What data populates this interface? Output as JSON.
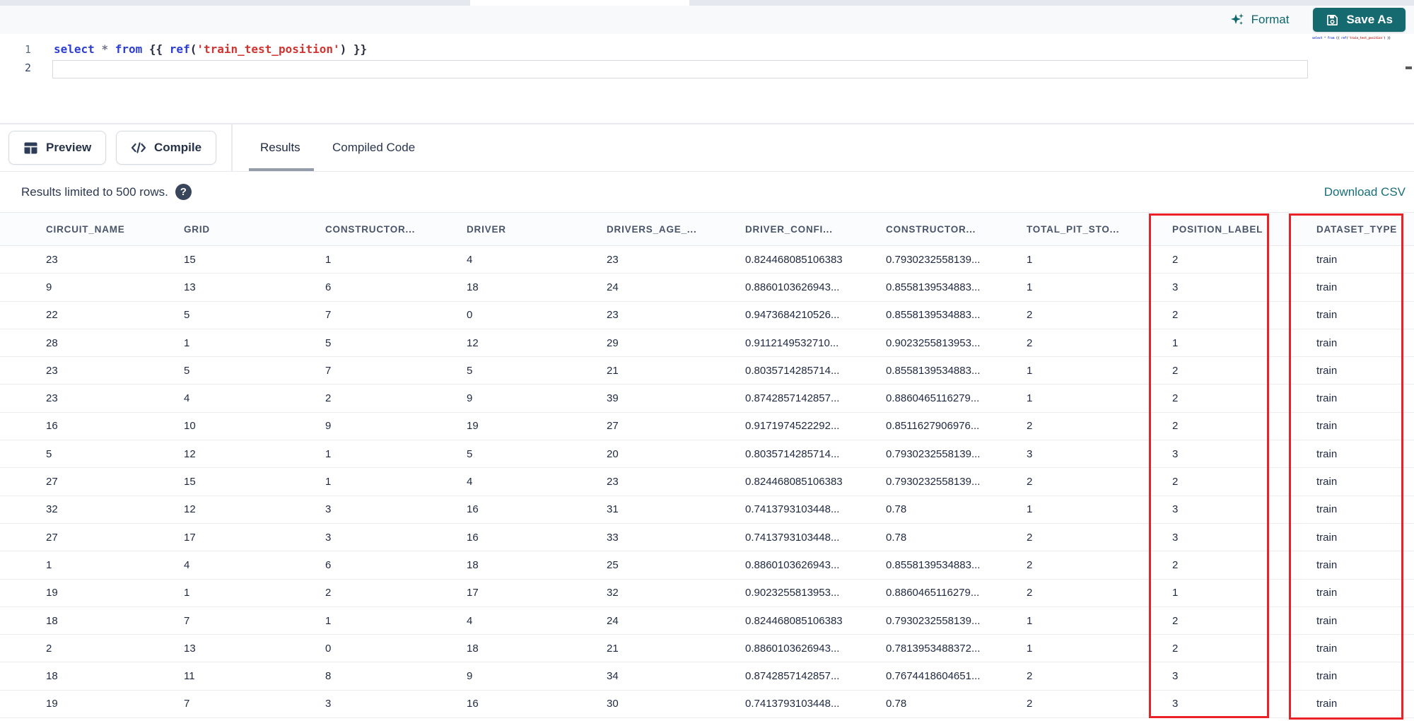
{
  "toolbar": {
    "format_label": "Format",
    "save_as_label": "Save As"
  },
  "editor": {
    "line_numbers": [
      "1",
      "2"
    ],
    "lines": [
      {
        "number": "1",
        "tokens": [
          {
            "t": "select",
            "c": "keyword"
          },
          {
            "t": " ",
            "c": "plain"
          },
          {
            "t": "*",
            "c": "operator"
          },
          {
            "t": " ",
            "c": "plain"
          },
          {
            "t": "from",
            "c": "keyword"
          },
          {
            "t": " ",
            "c": "plain"
          },
          {
            "t": "{{",
            "c": "brace"
          },
          {
            "t": " ",
            "c": "plain"
          },
          {
            "t": "ref",
            "c": "keyword"
          },
          {
            "t": "(",
            "c": "brace"
          },
          {
            "t": "'train_test_position'",
            "c": "string"
          },
          {
            "t": ")",
            "c": "brace"
          },
          {
            "t": " ",
            "c": "plain"
          },
          {
            "t": "}}",
            "c": "brace"
          }
        ]
      },
      {
        "number": "2",
        "tokens": []
      }
    ]
  },
  "actions": {
    "preview_label": "Preview",
    "compile_label": "Compile"
  },
  "tabs": {
    "results_label": "Results",
    "compiled_code_label": "Compiled Code",
    "active": "Results"
  },
  "results_info": {
    "limit_text": "Results limited to 500 rows.",
    "help_glyph": "?",
    "download_csv_label": "Download CSV"
  },
  "results_table": {
    "columns": [
      "CIRCUIT_NAME",
      "GRID",
      "CONSTRUCTOR...",
      "DRIVER",
      "DRIVERS_AGE_...",
      "DRIVER_CONFI...",
      "CONSTRUCTOR...",
      "TOTAL_PIT_STO...",
      "POSITION_LABEL",
      "DATASET_TYPE"
    ],
    "highlighted_columns": [
      "POSITION_LABEL",
      "DATASET_TYPE"
    ],
    "rows": [
      [
        "23",
        "15",
        "1",
        "4",
        "23",
        "0.824468085106383",
        "0.7930232558139...",
        "1",
        "2",
        "train"
      ],
      [
        "9",
        "13",
        "6",
        "18",
        "24",
        "0.8860103626943...",
        "0.8558139534883...",
        "1",
        "3",
        "train"
      ],
      [
        "22",
        "5",
        "7",
        "0",
        "23",
        "0.9473684210526...",
        "0.8558139534883...",
        "2",
        "2",
        "train"
      ],
      [
        "28",
        "1",
        "5",
        "12",
        "29",
        "0.9112149532710...",
        "0.9023255813953...",
        "2",
        "1",
        "train"
      ],
      [
        "23",
        "5",
        "7",
        "5",
        "21",
        "0.8035714285714...",
        "0.8558139534883...",
        "1",
        "2",
        "train"
      ],
      [
        "23",
        "4",
        "2",
        "9",
        "39",
        "0.8742857142857...",
        "0.8860465116279...",
        "1",
        "2",
        "train"
      ],
      [
        "16",
        "10",
        "9",
        "19",
        "27",
        "0.9171974522292...",
        "0.8511627906976...",
        "2",
        "2",
        "train"
      ],
      [
        "5",
        "12",
        "1",
        "5",
        "20",
        "0.8035714285714...",
        "0.7930232558139...",
        "3",
        "3",
        "train"
      ],
      [
        "27",
        "15",
        "1",
        "4",
        "23",
        "0.824468085106383",
        "0.7930232558139...",
        "2",
        "2",
        "train"
      ],
      [
        "32",
        "12",
        "3",
        "16",
        "31",
        "0.7413793103448...",
        "0.78",
        "1",
        "3",
        "train"
      ],
      [
        "27",
        "17",
        "3",
        "16",
        "33",
        "0.7413793103448...",
        "0.78",
        "2",
        "3",
        "train"
      ],
      [
        "1",
        "4",
        "6",
        "18",
        "25",
        "0.8860103626943...",
        "0.8558139534883...",
        "2",
        "2",
        "train"
      ],
      [
        "19",
        "1",
        "2",
        "17",
        "32",
        "0.9023255813953...",
        "0.8860465116279...",
        "2",
        "1",
        "train"
      ],
      [
        "18",
        "7",
        "1",
        "4",
        "24",
        "0.824468085106383",
        "0.7930232558139...",
        "1",
        "2",
        "train"
      ],
      [
        "2",
        "13",
        "0",
        "18",
        "21",
        "0.8860103626943...",
        "0.7813953488372...",
        "1",
        "2",
        "train"
      ],
      [
        "18",
        "11",
        "8",
        "9",
        "34",
        "0.8742857142857...",
        "0.7674418604651...",
        "2",
        "3",
        "train"
      ],
      [
        "19",
        "7",
        "3",
        "16",
        "30",
        "0.7413793103448...",
        "0.78",
        "2",
        "3",
        "train"
      ]
    ]
  },
  "icons": {
    "format": "sparkles",
    "save_as": "floppy-disk",
    "preview": "table-grid",
    "compile": "code-brackets",
    "help": "question-mark-circle"
  },
  "colors": {
    "accent_teal": "#156a70",
    "link_teal": "#186e78",
    "highlight_red": "#ea2127",
    "keyword_blue": "#2c3ed2",
    "string_red": "#cf3430"
  }
}
